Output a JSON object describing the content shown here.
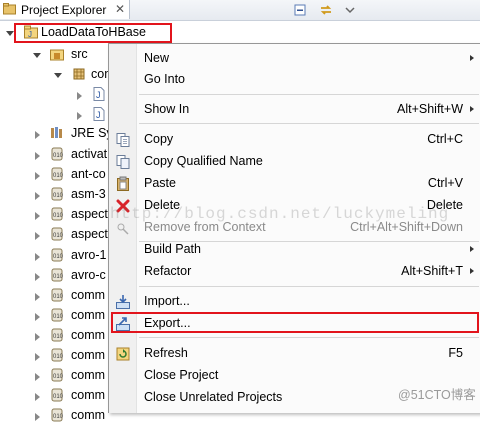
{
  "view": {
    "tab_title": "Project Explorer",
    "tab_close": "✕"
  },
  "tree": {
    "root": "LoadDataToHBase",
    "src": "src",
    "package": "com",
    "jre": "JRE Sy",
    "jars": [
      "activat",
      "ant-co",
      "asm-3",
      "aspect",
      "aspect",
      "avro-1",
      "avro-c",
      "comm",
      "comm",
      "comm",
      "comm",
      "comm",
      "comm",
      "comm"
    ]
  },
  "menu": {
    "items": [
      {
        "label": "New",
        "key": "",
        "submenu": true
      },
      {
        "label": "Go Into",
        "key": ""
      },
      {
        "label": "Show In",
        "key": "Alt+Shift+W",
        "submenu": true
      },
      {
        "label": "Copy",
        "key": "Ctrl+C"
      },
      {
        "label": "Copy Qualified Name",
        "key": ""
      },
      {
        "label": "Paste",
        "key": "Ctrl+V"
      },
      {
        "label": "Delete",
        "key": "Delete"
      },
      {
        "label": "Remove from Context",
        "key": "Ctrl+Alt+Shift+Down",
        "disabled": true
      },
      {
        "label": "Build Path",
        "key": "",
        "submenu": true
      },
      {
        "label": "Refactor",
        "key": "Alt+Shift+T",
        "submenu": true
      },
      {
        "label": "Import...",
        "key": ""
      },
      {
        "label": "Export...",
        "key": ""
      },
      {
        "label": "Refresh",
        "key": "F5"
      },
      {
        "label": "Close Project",
        "key": ""
      },
      {
        "label": "Close Unrelated Projects",
        "key": ""
      }
    ],
    "icons": [
      "copy-icon",
      "copy-qualified-icon",
      "paste-icon",
      "delete-icon",
      "remove-context-icon",
      "import-icon",
      "export-icon",
      "refresh-icon"
    ],
    "highlight_color": "#e2141c"
  },
  "watermark": "http://blog.csdn.net/luckymeling",
  "site_mark": "@51CTO博客"
}
